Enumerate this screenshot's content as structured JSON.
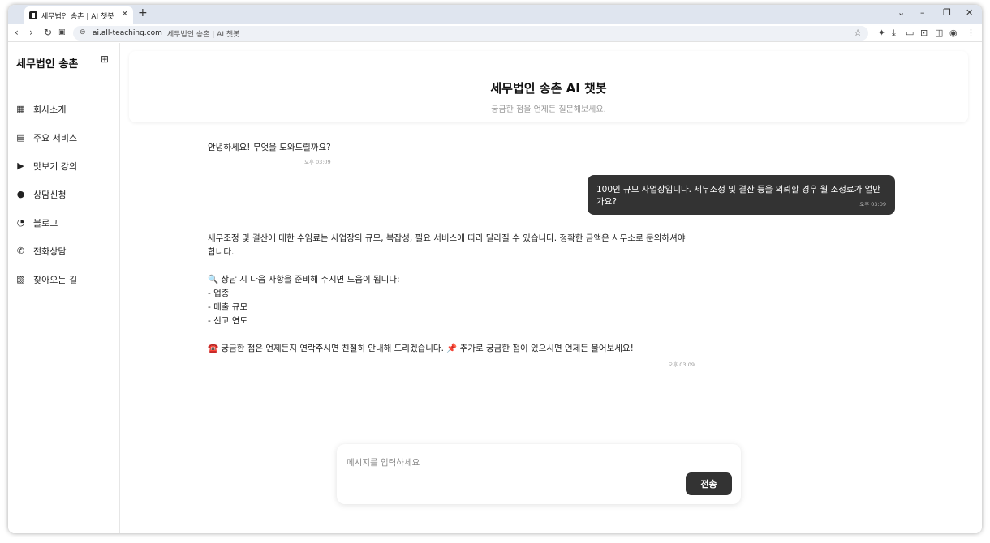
{
  "browser": {
    "tab_title": "세무법인 송촌 | AI 챗봇",
    "url_host": "ai.all-teaching.com",
    "url_title": "세무법인 송촌 | AI 챗봇"
  },
  "sidebar": {
    "brand": "세무법인 송촌",
    "items": [
      {
        "label": "회사소개",
        "icon": "building-icon"
      },
      {
        "label": "주요 서비스",
        "icon": "clipboard-icon"
      },
      {
        "label": "맛보기 강의",
        "icon": "play-circle-icon"
      },
      {
        "label": "상담신청",
        "icon": "chat-bubbles-icon"
      },
      {
        "label": "블로그",
        "icon": "rss-icon"
      },
      {
        "label": "전화상담",
        "icon": "phone-icon"
      },
      {
        "label": "찾아오는 길",
        "icon": "map-icon"
      }
    ]
  },
  "header": {
    "title": "세무법인 송촌 AI 챗봇",
    "subtitle": "궁금한 점을 언제든 질문해보세요."
  },
  "messages": [
    {
      "role": "bot",
      "text": "안녕하세요! 무엇을 도와드릴까요?",
      "time": "오후 03:09"
    },
    {
      "role": "user",
      "text": "100인 규모 사업장입니다. 세무조정 및 결산 등을 의뢰할 경우 월 조정료가 얼만가요?",
      "time": "오후 03:09"
    },
    {
      "role": "bot",
      "lines": [
        "세무조정 및 결산에 대한 수임료는 사업장의 규모, 복잡성, 필요 서비스에 따라 달라질 수 있습니다. 정확한 금액은 사무소로 문의하셔야 합니다.",
        "",
        "🔍 상담 시 다음 사항을 준비해 주시면 도움이 됩니다:",
        "- 업종",
        "- 매출 규모",
        "- 신고 연도",
        "",
        "☎️ 궁금한 점은 언제든지 연락주시면 친절히 안내해 드리겠습니다. 📌 추가로 궁금한 점이 있으시면 언제든 물어보세요!"
      ],
      "time": "오후 03:09"
    }
  ],
  "composer": {
    "placeholder": "메시지를 입력하세요",
    "send_label": "전송"
  }
}
